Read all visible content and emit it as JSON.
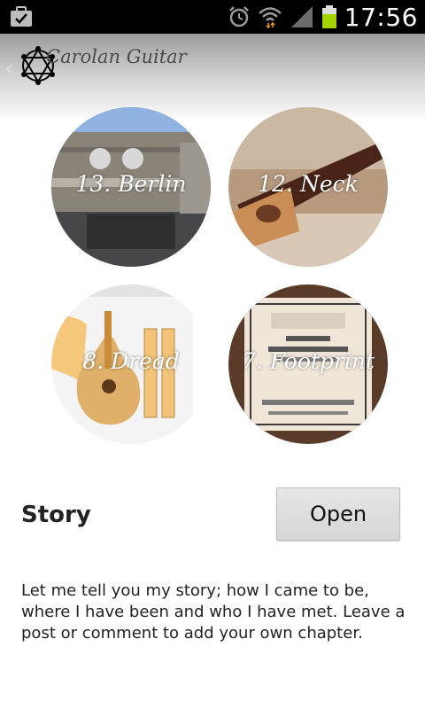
{
  "status_bar": {
    "time": "17:56",
    "icons": [
      "briefcase-check-icon",
      "alarm-icon",
      "wifi-icon",
      "signal-icon",
      "battery-icon"
    ],
    "battery_color": "#a4d300"
  },
  "header": {
    "title": "Carolan Guitar",
    "back_icon": "chevron-left-icon",
    "logo_icon": "hexagram-logo-icon"
  },
  "chapters": [
    {
      "label": "13. Berlin"
    },
    {
      "label": "12. Neck"
    },
    {
      "label": "8. Dread"
    },
    {
      "label": "7. Footprint"
    }
  ],
  "story": {
    "title": "Story",
    "open_label": "Open",
    "text": "Let me tell you my story; how I came to be, where I have been and who I have met. Leave a post or comment to add your own chapter."
  }
}
